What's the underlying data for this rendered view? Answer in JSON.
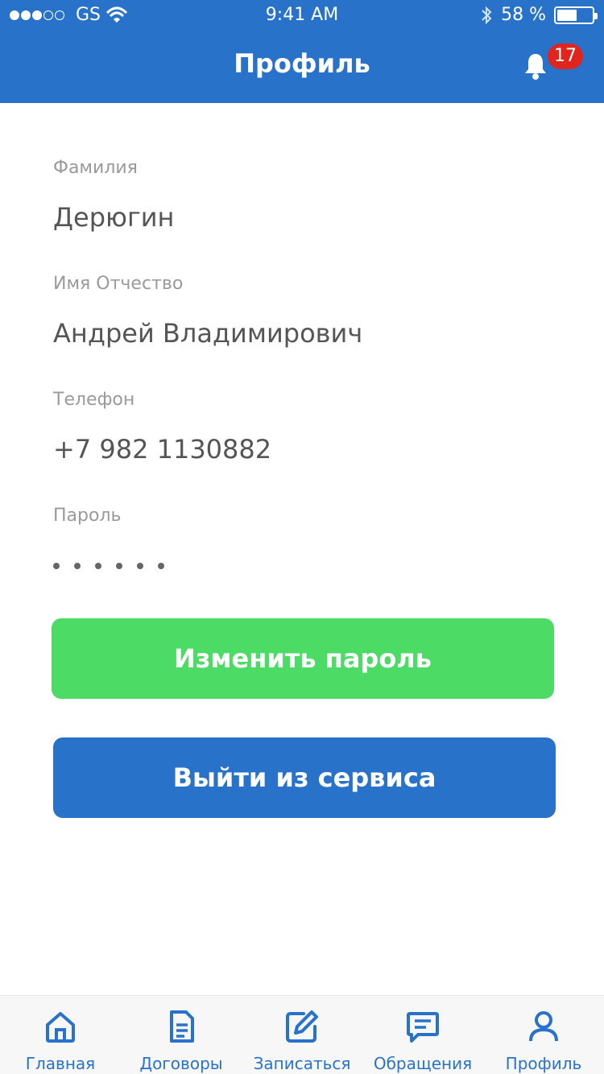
{
  "status_bar": {
    "carrier": "GS",
    "time": "9:41 AM",
    "battery_percent": 58,
    "battery_label": "58 %"
  },
  "header": {
    "title": "Профиль",
    "notification_count": "17"
  },
  "profile": {
    "last_name_label": "Фамилия",
    "last_name_value": "Дерюгин",
    "first_middle_label": "Имя Отчество",
    "first_middle_value": "Андрей Владимирович",
    "phone_label": "Телефон",
    "phone_value": "+7 982 1130882",
    "password_label": "Пароль",
    "password_mask_count": 6
  },
  "actions": {
    "change_password": "Изменить пароль",
    "logout": "Выйти из сервиса"
  },
  "tabbar": {
    "items": [
      {
        "label": "Главная",
        "icon": "home-icon"
      },
      {
        "label": "Договоры",
        "icon": "document-icon"
      },
      {
        "label": "Записаться",
        "icon": "edit-icon"
      },
      {
        "label": "Обращения",
        "icon": "message-icon"
      },
      {
        "label": "Профиль",
        "icon": "user-icon"
      }
    ]
  },
  "colors": {
    "primary": "#2873c9",
    "success": "#4cdc66",
    "badge": "#e0261c"
  }
}
